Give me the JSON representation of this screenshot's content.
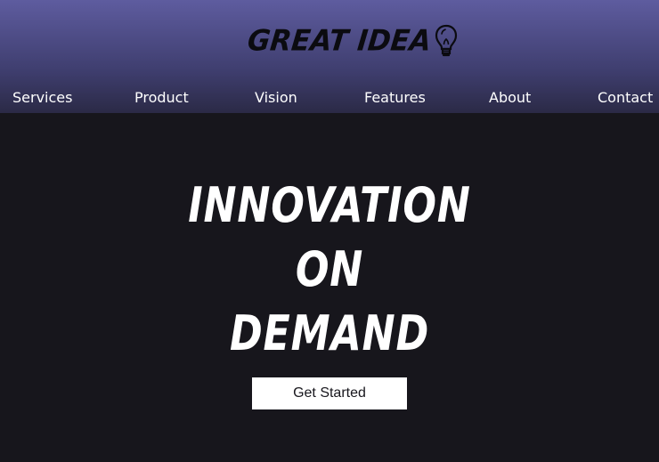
{
  "brand": {
    "name": "GREAT IDEA",
    "icon": "lightbulb-icon"
  },
  "nav": {
    "items": [
      {
        "label": "Services"
      },
      {
        "label": "Product"
      },
      {
        "label": "Vision"
      },
      {
        "label": "Features"
      },
      {
        "label": "About"
      },
      {
        "label": "Contact"
      }
    ]
  },
  "hero": {
    "lines": [
      "INNOVATION",
      "ON",
      "DEMAND"
    ],
    "cta_label": "Get Started"
  },
  "colors": {
    "header_top": "#5e5c9f",
    "header_bottom": "#2b2a46",
    "page_background": "#17161c",
    "text_primary": "#ffffff",
    "logo_text": "#0b0b10"
  }
}
